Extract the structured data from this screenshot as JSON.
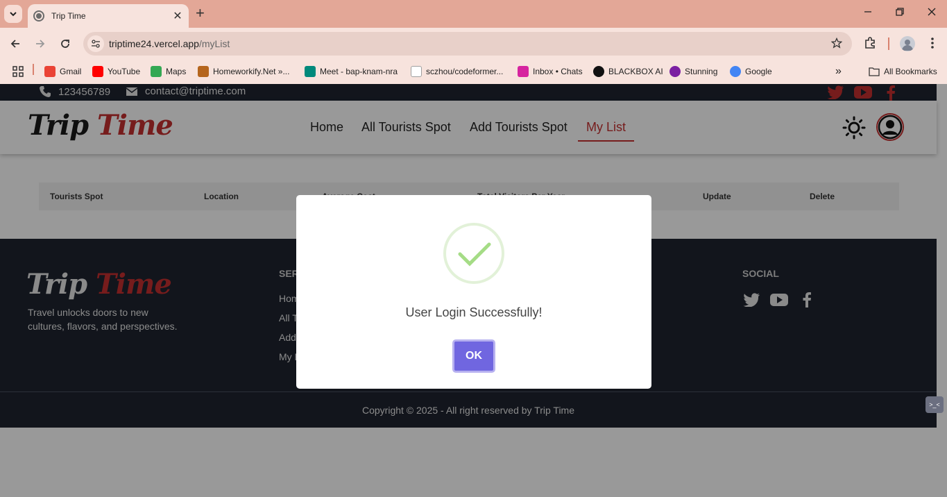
{
  "browser": {
    "tab_title": "Trip Time",
    "url_host": "triptime24.vercel.app",
    "url_path": "/myList",
    "bookmarks": [
      {
        "label": "Gmail",
        "icon": "gmail-icon",
        "color": "#ea4335"
      },
      {
        "label": "YouTube",
        "icon": "youtube-icon",
        "color": "#ff0000"
      },
      {
        "label": "Maps",
        "icon": "maps-icon",
        "color": "#34a853"
      },
      {
        "label": "Homeworkify.Net »...",
        "icon": "books-icon",
        "color": "#b5651d"
      },
      {
        "label": "Meet - bap-knam-nra",
        "icon": "meet-icon",
        "color": "#00897b"
      },
      {
        "label": "sczhou/codeformer...",
        "icon": "doc-icon",
        "color": "#9e9e9e"
      },
      {
        "label": "Inbox • Chats",
        "icon": "instagram-icon",
        "color": "#d6249f"
      },
      {
        "label": "BLACKBOX AI",
        "icon": "blackbox-icon",
        "color": "#111111"
      },
      {
        "label": "Stunning",
        "icon": "stunning-icon",
        "color": "#7b1fa2"
      },
      {
        "label": "Google",
        "icon": "google-icon",
        "color": "#4285f4"
      }
    ],
    "all_bookmarks": "All Bookmarks"
  },
  "site": {
    "phone": "123456789",
    "email": "contact@triptime.com",
    "logo_part1": "Trip",
    "logo_part2": "Time",
    "nav": [
      "Home",
      "All Tourists Spot",
      "Add Tourists Spot",
      "My List"
    ],
    "table_headers": [
      "Tourists Spot",
      "Location",
      "Average Cost",
      "Total Visitors Per Year",
      "Update",
      "Delete"
    ],
    "footer": {
      "tagline": "Travel unlocks doors to new cultures, flavors, and perspectives.",
      "services_heading": "SERVICES",
      "service_links": [
        "Home",
        "All Tourists Spot",
        "Add Tourists Spot",
        "My List"
      ],
      "social_heading": "SOCIAL",
      "copyright": "Copyright © 2025 - All right reserved by Trip Time"
    },
    "colors": {
      "accent": "#c53030",
      "dark": "#1e2430",
      "modal_button": "#7066e0",
      "success": "#a5dc86"
    }
  },
  "modal": {
    "message": "User Login Successfully!",
    "ok_label": "OK"
  }
}
